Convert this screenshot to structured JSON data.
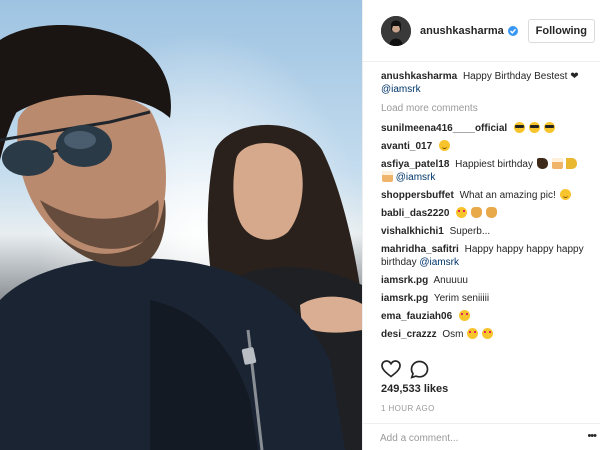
{
  "post": {
    "username": "anushkasharma",
    "follow_label": "Following",
    "caption": {
      "user": "anushkasharma",
      "text": "Happy Birthday Bestest",
      "heart": "❤",
      "mention": "@iamsrk"
    },
    "load_more": "Load more comments",
    "comments": [
      {
        "user": "sunilmeena416____official",
        "text": "",
        "mention": ""
      },
      {
        "user": "avanti_017",
        "text": "",
        "mention": ""
      },
      {
        "user": "asfiya_patel18",
        "text": "Happiest birthday",
        "mention": "@iamsrk"
      },
      {
        "user": "shoppersbuffet",
        "text": "What an amazing pic!",
        "mention": ""
      },
      {
        "user": "babli_das2220",
        "text": "",
        "mention": ""
      },
      {
        "user": "vishalkhichi1",
        "text": "Superb...",
        "mention": ""
      },
      {
        "user": "mahridha_safitri",
        "text": "Happy happy happy happy birthday",
        "mention": "@iamsrk"
      },
      {
        "user": "iamsrk.pg",
        "text": "Anuuuu",
        "mention": ""
      },
      {
        "user": "iamsrk.pg",
        "text": "Yerim seniiiii",
        "mention": ""
      },
      {
        "user": "ema_fauziah06",
        "text": "",
        "mention": ""
      },
      {
        "user": "desi_crazzz",
        "text": "Osm",
        "mention": ""
      }
    ],
    "emoji": {
      "c0": [
        "smiling-face-with-sunglasses",
        "smiling-face-with-sunglasses",
        "smiling-face-with-sunglasses"
      ],
      "c1": [
        "smiling-face"
      ],
      "c2": [
        "party-popper",
        "birthday-cake",
        "party-horn",
        "birthday-cake"
      ],
      "c3": [
        "smiling-face"
      ],
      "c4": [
        "heart-eyes",
        "clapping-hands",
        "clapping-hands"
      ],
      "c9": [
        "heart-eyes"
      ],
      "c10": [
        "heart-eyes",
        "heart-eyes"
      ]
    },
    "likes": "249,533 likes",
    "time": "1 HOUR AGO",
    "add_comment_placeholder": "Add a comment...",
    "more_label": "•••"
  },
  "icons": {
    "verified": "verified-badge-icon",
    "like": "heart-outline-icon",
    "comment": "speech-bubble-icon",
    "more": "ellipsis-icon"
  },
  "colors": {
    "verified_blue": "#3897f0",
    "mention_blue": "#003569",
    "muted_gray": "#999999",
    "text": "#262626",
    "divider": "#efefef"
  }
}
